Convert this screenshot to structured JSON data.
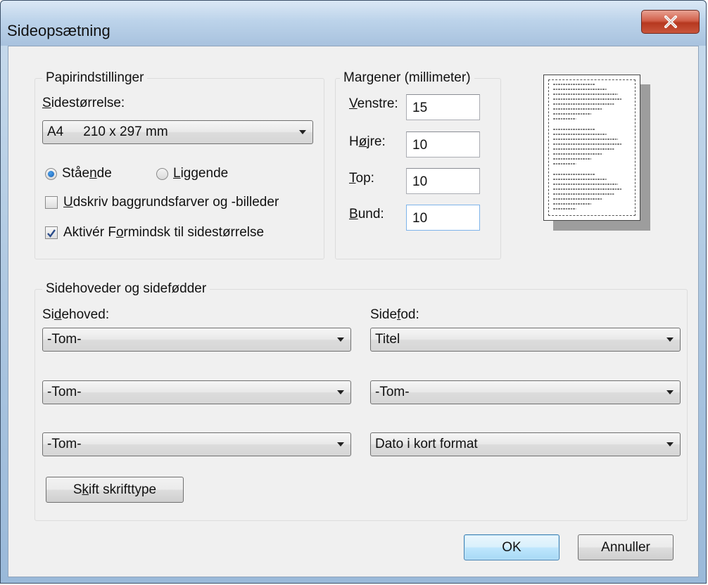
{
  "window": {
    "title": "Sideopsætning",
    "close_icon": "close-icon"
  },
  "paper": {
    "legend": "Papirindstillinger",
    "size_label_u": "S",
    "size_label_rest": "idestørrelse:",
    "size_name": "A4",
    "size_dims": "210 x 297 mm",
    "orientation_portrait_pre": "Ståe",
    "orientation_portrait_u": "n",
    "orientation_portrait_post": "de",
    "orientation_landscape_u": "L",
    "orientation_landscape_rest": "iggende",
    "orientation_selected": "portrait",
    "print_bg_u": "U",
    "print_bg_rest": "dskriv baggrundsfarver og -billeder",
    "print_bg_checked": false,
    "shrink_pre": "Aktivér F",
    "shrink_u": "o",
    "shrink_post": "rmindsk til sidestørrelse",
    "shrink_checked": true
  },
  "margins": {
    "legend": "Margener (millimeter)",
    "left_u": "V",
    "left_rest": "enstre:",
    "left_value": "15",
    "right_pre": "H",
    "right_u": "ø",
    "right_post": "jre:",
    "right_value": "10",
    "top_u": "T",
    "top_rest": "op:",
    "top_value": "10",
    "bottom_u": "B",
    "bottom_rest": "und:",
    "bottom_value": "10"
  },
  "headers": {
    "legend": "Sidehoveder og sidefødder",
    "header_label_pre": "Si",
    "header_label_u": "d",
    "header_label_post": "ehoved:",
    "footer_label_pre": "Side",
    "footer_label_u": "f",
    "footer_label_post": "od:",
    "header_1": "-Tom-",
    "header_2": "-Tom-",
    "header_3": "-Tom-",
    "footer_1": "Titel",
    "footer_2": "-Tom-",
    "footer_3": "Dato i kort format",
    "font_button_pre": "S",
    "font_button_u": "k",
    "font_button_post": "ift skrifttype"
  },
  "buttons": {
    "ok": "OK",
    "cancel": "Annuller"
  }
}
